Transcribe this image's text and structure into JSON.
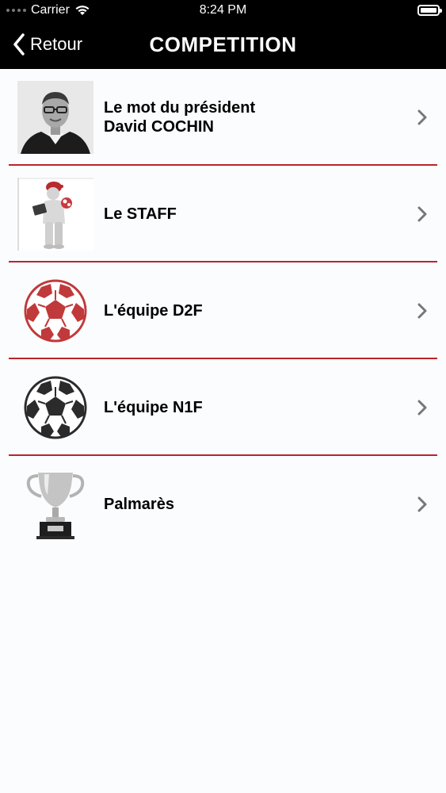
{
  "status_bar": {
    "carrier": "Carrier",
    "time": "8:24 PM"
  },
  "nav": {
    "back_label": "Retour",
    "title": "COMPETITION"
  },
  "items": [
    {
      "line1": "Le mot du président",
      "line2": "David COCHIN",
      "icon": "president-photo"
    },
    {
      "line1": "Le STAFF",
      "line2": "",
      "icon": "staff-figure-icon"
    },
    {
      "line1": "L'équipe D2F",
      "line2": "",
      "icon": "red-soccer-ball-icon"
    },
    {
      "line1": "L'équipe N1F",
      "line2": "",
      "icon": "black-soccer-ball-icon"
    },
    {
      "line1": "Palmarès",
      "line2": "",
      "icon": "trophy-icon"
    }
  ],
  "colors": {
    "separator": "#b8252c",
    "accent_red": "#c0393b",
    "bar_bg": "#000000"
  }
}
